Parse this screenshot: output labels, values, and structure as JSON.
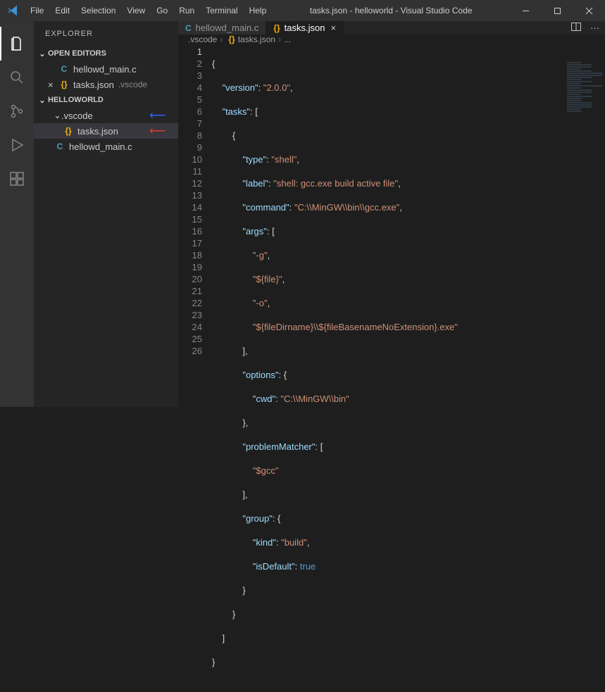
{
  "title": "tasks.json - helloworld - Visual Studio Code",
  "menu": [
    "File",
    "Edit",
    "Selection",
    "View",
    "Go",
    "Run",
    "Terminal",
    "Help"
  ],
  "explorer": {
    "title": "EXPLORER",
    "open_editors": "OPEN EDITORS",
    "workspace": "HELLOWORLD",
    "files": {
      "hellowd_main": "hellowd_main.c",
      "tasks_json": "tasks.json",
      "vscode_dir": ".vscode",
      "vscode_desc": ".vscode"
    }
  },
  "tabs": {
    "hellowd": "hellowd_main.c",
    "tasks": "tasks.json"
  },
  "breadcrumbs": {
    "dir": ".vscode",
    "file": "tasks.json",
    "tail": "..."
  },
  "code": {
    "l1": "{",
    "l2a": "    ",
    "l2k": "\"version\"",
    "l2p": ": ",
    "l2v": "\"2.0.0\"",
    "l2e": ",",
    "l3a": "    ",
    "l3k": "\"tasks\"",
    "l3p": ": [",
    "l4": "        {",
    "l5a": "            ",
    "l5k": "\"type\"",
    "l5p": ": ",
    "l5v": "\"shell\"",
    "l5e": ",",
    "l6a": "            ",
    "l6k": "\"label\"",
    "l6p": ": ",
    "l6v": "\"shell: gcc.exe build active file\"",
    "l6e": ",",
    "l7a": "            ",
    "l7k": "\"command\"",
    "l7p": ": ",
    "l7v": "\"C:\\\\MinGW\\\\bin\\\\gcc.exe\"",
    "l7e": ",",
    "l8a": "            ",
    "l8k": "\"args\"",
    "l8p": ": [",
    "l9a": "                ",
    "l9v": "\"-g\"",
    "l9e": ",",
    "l10a": "                ",
    "l10v": "\"${file}\"",
    "l10e": ",",
    "l11a": "                ",
    "l11v": "\"-o\"",
    "l11e": ",",
    "l12a": "                ",
    "l12v": "\"${fileDirname}\\\\${fileBasenameNoExtension}.exe\"",
    "l13": "            ],",
    "l14a": "            ",
    "l14k": "\"options\"",
    "l14p": ": {",
    "l15a": "                ",
    "l15k": "\"cwd\"",
    "l15p": ": ",
    "l15v": "\"C:\\\\MinGW\\\\bin\"",
    "l16": "            },",
    "l17a": "            ",
    "l17k": "\"problemMatcher\"",
    "l17p": ": [",
    "l18a": "                ",
    "l18v": "\"$gcc\"",
    "l19": "            ],",
    "l20a": "            ",
    "l20k": "\"group\"",
    "l20p": ": {",
    "l21a": "                ",
    "l21k": "\"kind\"",
    "l21p": ": ",
    "l21v": "\"build\"",
    "l21e": ",",
    "l22a": "                ",
    "l22k": "\"isDefault\"",
    "l22p": ": ",
    "l22v": "true",
    "l23": "            }",
    "l24": "        }",
    "l25": "    ]",
    "l26": "}"
  },
  "line_count": 26
}
